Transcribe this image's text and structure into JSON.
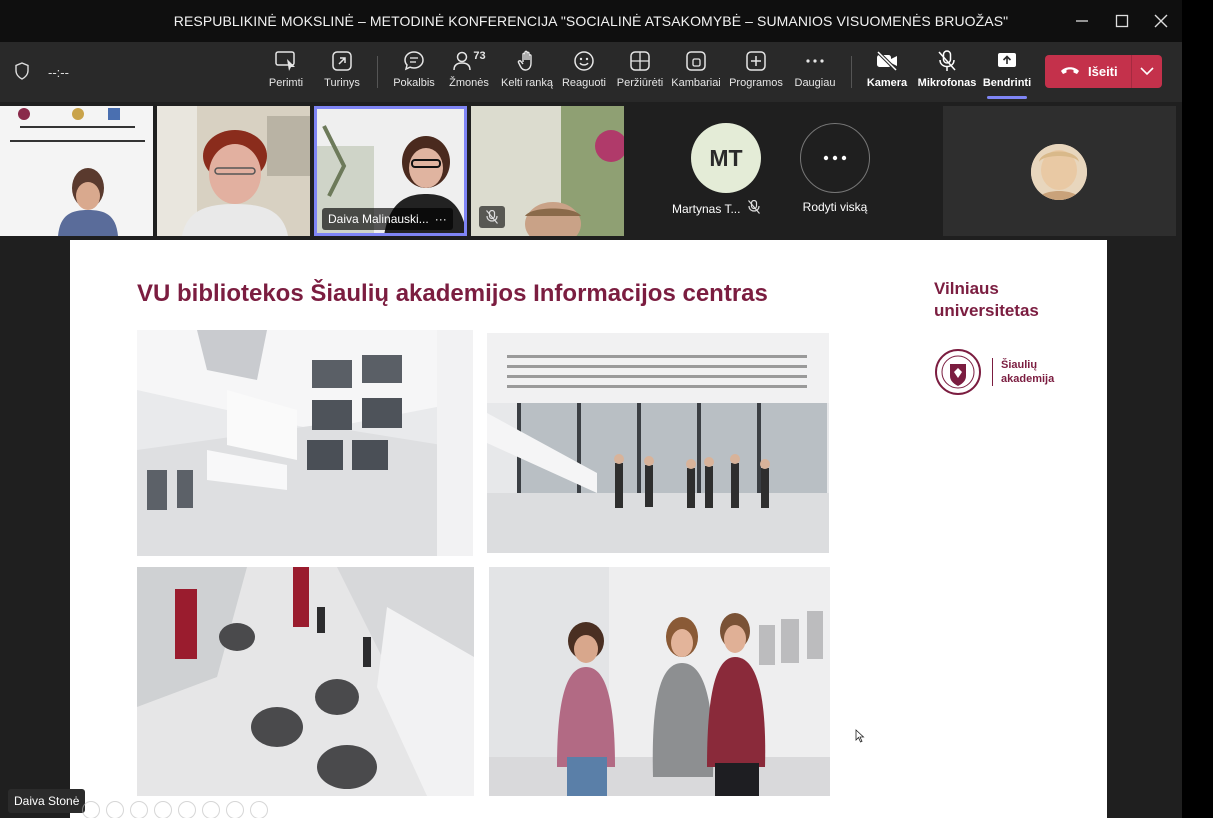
{
  "window": {
    "title": "RESPUBLIKINĖ MOKSLINĖ – METODINĖ KONFERENCIJA \"SOCIALINĖ ATSAKOMYBĖ – SUMANIOS VISUOMENĖS BRUOŽAS\"",
    "controls": [
      "minimize-icon",
      "maximize-icon",
      "close-icon"
    ]
  },
  "toolbar": {
    "timer": "--:--",
    "buttons": [
      {
        "label": "Perimti",
        "icon": "take-control-icon"
      },
      {
        "label": "Turinys",
        "icon": "content-icon"
      },
      {
        "label": "Pokalbis",
        "icon": "chat-icon"
      },
      {
        "label": "Žmonės",
        "icon": "people-icon",
        "count": "73"
      },
      {
        "label": "Kelti ranką",
        "icon": "raise-hand-icon"
      },
      {
        "label": "Reaguoti",
        "icon": "react-icon"
      },
      {
        "label": "Peržiūrėti",
        "icon": "view-icon"
      },
      {
        "label": "Kambariai",
        "icon": "rooms-icon"
      },
      {
        "label": "Programos",
        "icon": "apps-icon"
      },
      {
        "label": "Daugiau",
        "icon": "more-icon"
      },
      {
        "label": "Kamera",
        "icon": "camera-off-icon"
      },
      {
        "label": "Mikrofonas",
        "icon": "mic-off-icon"
      },
      {
        "label": "Bendrinti",
        "icon": "share-icon"
      }
    ],
    "leave_label": "Išeiti"
  },
  "gallery": {
    "tiles": [
      {
        "name": ""
      },
      {
        "name": ""
      },
      {
        "name": "Daiva Malinauski..."
      },
      {
        "name": ""
      }
    ],
    "participant_initials": "MT",
    "participant_name": "Martynas T...",
    "show_all_label": "Rodyti viską"
  },
  "slide": {
    "title": "VU bibliotekos Šiaulių akademijos Informacijos centras",
    "university_line1": "Vilniaus",
    "university_line2": "universitetas",
    "academy_line1": "Šiaulių",
    "academy_line2": "akademija"
  },
  "presenter_name": "Daiva Stonė",
  "colors": {
    "accent": "#7f85f5",
    "leave": "#c4314b",
    "brand": "#7b1d40"
  }
}
